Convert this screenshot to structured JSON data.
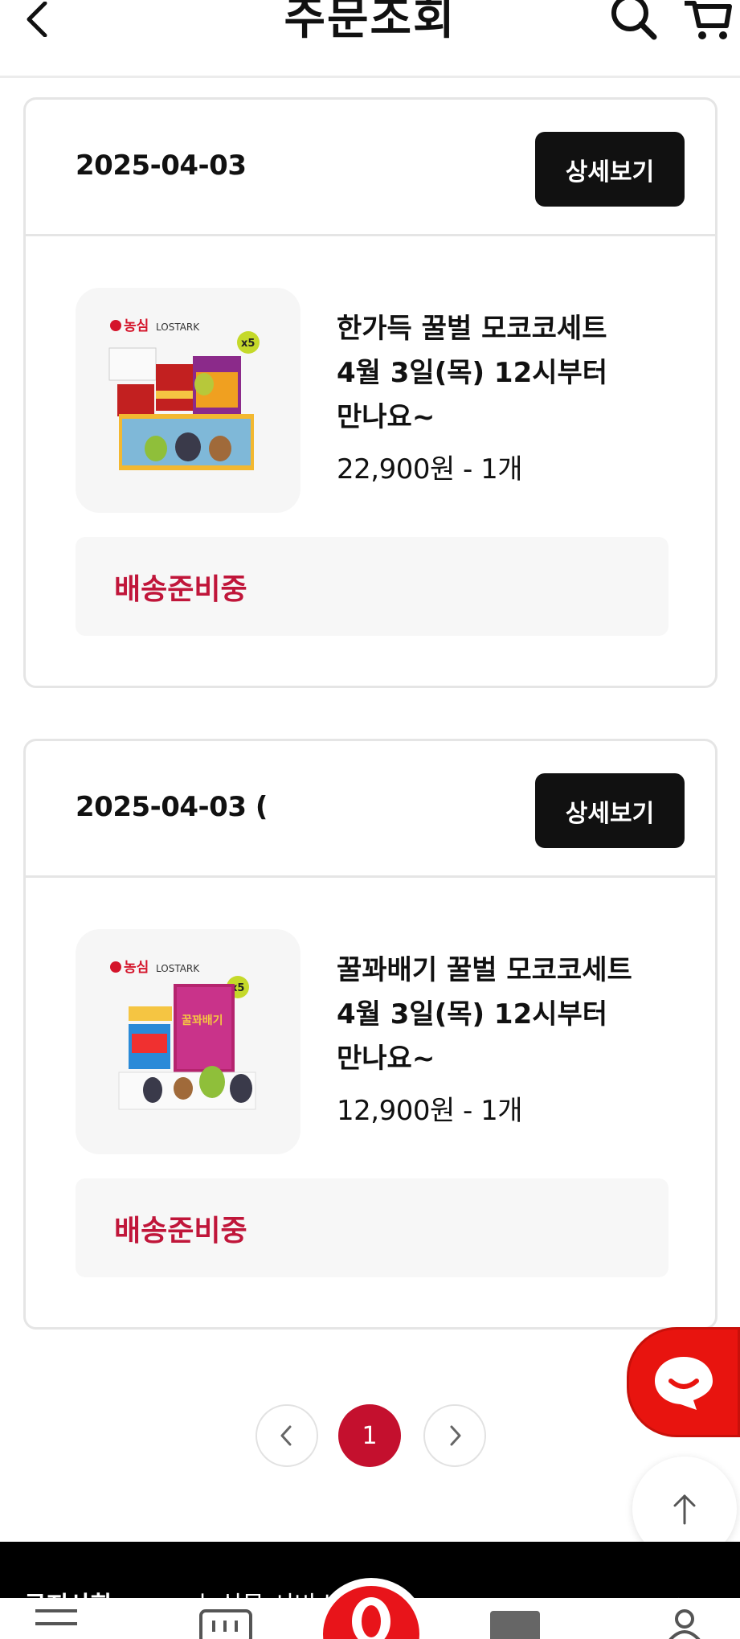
{
  "header": {
    "title": "주문조회"
  },
  "orders": [
    {
      "date": "2025-04-03",
      "detail_label": "상세보기",
      "product_name_lines": [
        "한가득 꿀벌 모코코세트",
        "4월 3일(목) 12시부터",
        "만나요~"
      ],
      "price": "22,900원 - 1개",
      "status": "배송준비중"
    },
    {
      "date": "2025-04-03 (",
      "detail_label": "상세보기",
      "product_name_lines": [
        "꿀꽈배기 꿀벌 모코코세트",
        "4월 3일(목) 12시부터",
        "만나요~"
      ],
      "price": "12,900원 - 1개",
      "status": "배송준비중"
    }
  ],
  "product_art": {
    "brand_left": "농심",
    "brand_right": "LOSTARK",
    "multiplier": "x5",
    "box_label": "꿀꽈배기"
  },
  "pagination": {
    "current": "1"
  },
  "footer": {
    "notice_label": "공지사항",
    "notice_text": "농심몰 서비스 안내"
  },
  "colors": {
    "accent_red": "#c4102e",
    "status_red": "#c0163a",
    "chat_red": "#e8140f",
    "button_black": "#111111"
  }
}
